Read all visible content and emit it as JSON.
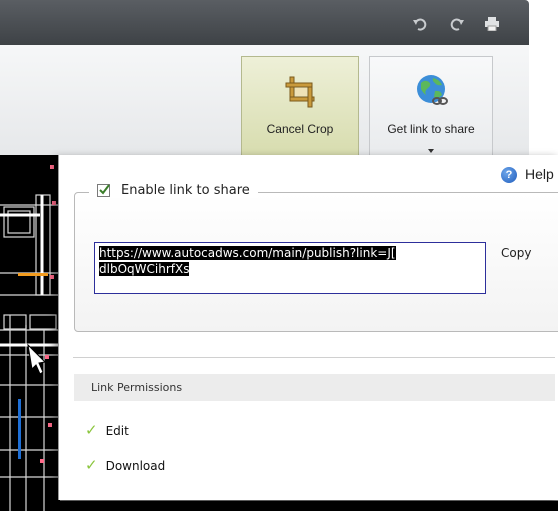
{
  "ribbon": {
    "cancel_crop_label": "Cancel Crop",
    "get_link_label": "Get link to share"
  },
  "panel": {
    "help_label": "Help",
    "enable_label": "Enable link to share",
    "enable_checked": true,
    "url_value_line1": "https://www.autocadws.com/main/publish?link=J[",
    "url_value_line2": "dlbOqWCihrfXs",
    "copy_label": "Copy",
    "permissions_header": "Link Permissions",
    "permissions": [
      {
        "label": "Edit",
        "enabled": true
      },
      {
        "label": "Download",
        "enabled": true
      }
    ]
  },
  "colors": {
    "accent_check": "#8cc63f",
    "url_border": "#2d2f9b",
    "titlebar": "#4a4e52"
  }
}
